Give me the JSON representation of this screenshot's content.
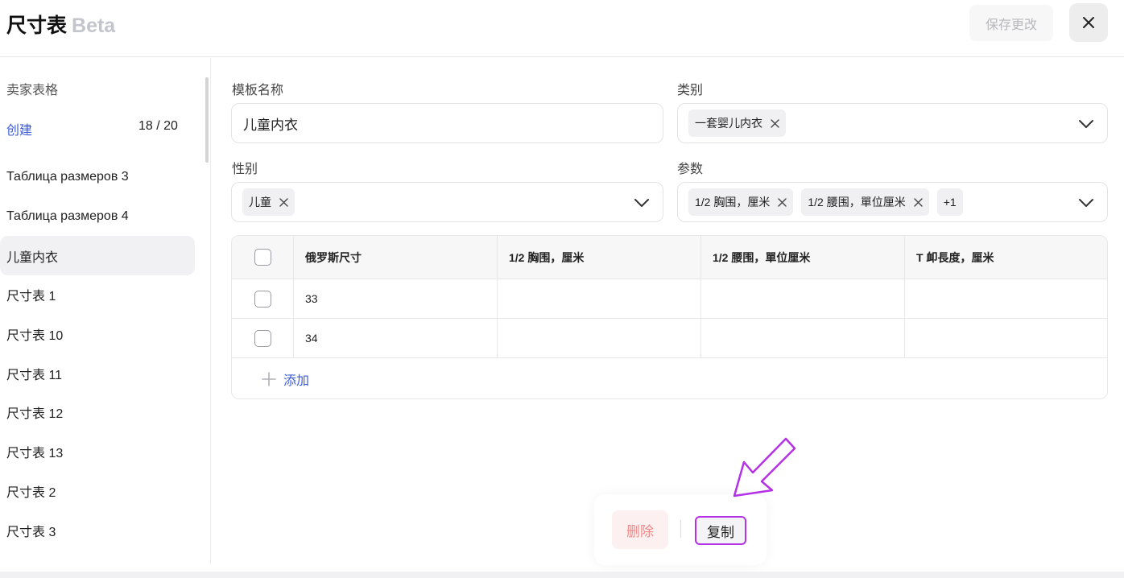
{
  "header": {
    "title": "尺寸表",
    "badge": "Beta",
    "save_label": "保存更改"
  },
  "sidebar": {
    "heading": "卖家表格",
    "create_label": "创建",
    "count": "18 / 20",
    "items": [
      {
        "label": "Таблица размеров 3"
      },
      {
        "label": "Таблица размеров 4"
      },
      {
        "label": "儿童内衣"
      },
      {
        "label": "尺寸表 1"
      },
      {
        "label": "尺寸表 10"
      },
      {
        "label": "尺寸表 11"
      },
      {
        "label": "尺寸表 12"
      },
      {
        "label": "尺寸表 13"
      },
      {
        "label": "尺寸表 2"
      },
      {
        "label": "尺寸表 3"
      }
    ]
  },
  "form": {
    "template_name": {
      "label": "模板名称",
      "value": "儿童内衣"
    },
    "category": {
      "label": "类别",
      "chips": [
        "一套婴儿内衣"
      ]
    },
    "gender": {
      "label": "性别",
      "chips": [
        "儿童"
      ]
    },
    "params": {
      "label": "参数",
      "chips": [
        "1/2 胸围，厘米",
        "1/2 腰围，單位厘米"
      ],
      "more": "+1"
    }
  },
  "table": {
    "columns": [
      "俄罗斯尺寸",
      "1/2 胸围，厘米",
      "1/2 腰围，單位厘米",
      "T 卹長度，厘米"
    ],
    "rows": [
      [
        "33",
        "",
        "",
        ""
      ],
      [
        "34",
        "",
        "",
        ""
      ]
    ],
    "add_label": "添加"
  },
  "actions": {
    "delete_label": "删除",
    "copy_label": "复制"
  },
  "colors": {
    "accent": "#3b5bdb",
    "highlight": "#b431e6",
    "danger": "#f08a8a"
  }
}
